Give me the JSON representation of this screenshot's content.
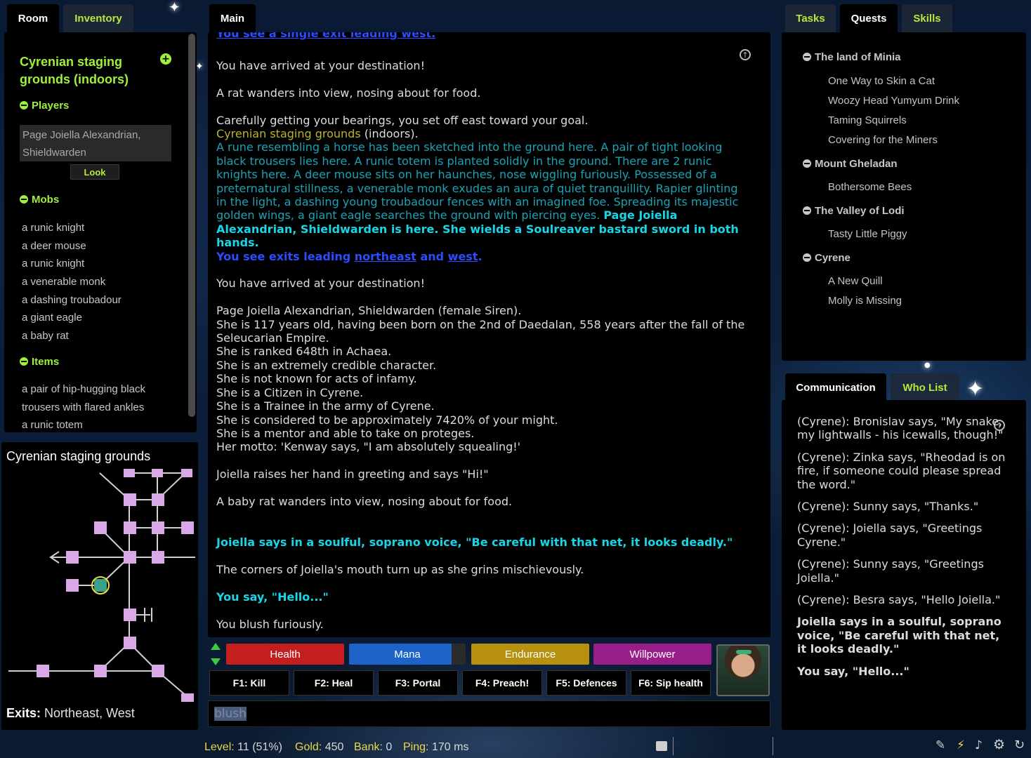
{
  "left_tabs": [
    "Room",
    "Inventory"
  ],
  "room": {
    "title": "Cyrenian staging grounds (indoors)",
    "players_heading": "Players",
    "player": "Page Joiella Alexandrian, Shieldwarden",
    "look_label": "Look",
    "mobs_heading": "Mobs",
    "mobs": [
      "a runic knight",
      "a deer mouse",
      "a runic knight",
      "a venerable monk",
      "a dashing troubadour",
      "a giant eagle",
      "a baby rat"
    ],
    "items_heading": "Items",
    "items": [
      "a pair of hip-hugging black trousers with flared ankles",
      "a runic totem"
    ]
  },
  "map": {
    "title": "Cyrenian staging grounds",
    "exits_label": "Exits:",
    "exits_value": "Northeast, West"
  },
  "main_tab": "Main",
  "main": {
    "top_cut": "You see a single exit leading west.",
    "arrived_1": "You have arrived at your destination!",
    "rat": "A rat wanders into view, nosing about for food.",
    "bearings": "Carefully getting your bearings, you set off east toward your goal.",
    "room_name": "Cyrenian staging grounds",
    "room_indoors": " (indoors).",
    "room_desc": "A rune resembling a horse has been sketched into the ground here. A pair of tight looking black trousers lies here. A runic totem is planted solidly in the ground. There are 2 runic knights here. A deer mouse sits on her haunches, nose wiggling furiously. Possessed of a preternatural stillness, a venerable monk exudes an aura of quiet tranquillity. Rapier glinting in the light, a dashing young troubadour fences with an imagined foe. Spreading its majestic golden wings, a giant eagle searches the ground with piercing eyes. ",
    "room_player": "Page Joiella Alexandrian, Shieldwarden is here. She wields a Soulreaver bastard sword in both hands.",
    "exits_prefix": "You see exits leading ",
    "exit_ne": "northeast",
    "exits_and": " and ",
    "exit_w": "west",
    "exits_end": ".",
    "arrived_2": "You have arrived at your destination!",
    "who": [
      "Page Joiella Alexandrian, Shieldwarden (female Siren).",
      "She is 117 years old, having been born on the 2nd of Daedalan, 558 years after the fall of the Seleucarian Empire.",
      "She is ranked 648th in Achaea.",
      "She is an extremely credible character.",
      "She is not known for acts of infamy.",
      "She is a Citizen in Cyrene.",
      "She is a Trainee in the army of Cyrene.",
      "She is considered to be approximately 7420% of your might.",
      "She is a mentor and able to take on proteges.",
      "Her motto: 'Kenway says, \"I am absolutely squealing!'"
    ],
    "greeting": "Joiella raises her hand in greeting and says \"Hi!\"",
    "baby_rat": "A baby rat wanders into view, nosing about for food.",
    "says": "Joiella says in a soulful, soprano voice, \"Be careful with that net, it looks deadly.\"",
    "grins": "The corners of Joiella's mouth turn up as she grins mischievously.",
    "you_say": "You say, \"Hello...\"",
    "blush": "You blush furiously."
  },
  "stats": {
    "health": "Health",
    "mana": "Mana",
    "endurance": "Endurance",
    "willpower": "Willpower",
    "colors": {
      "health": "#c41e1e",
      "mana": "#1e64c8",
      "endurance": "#b8900f",
      "willpower": "#9a1e8a"
    }
  },
  "fkeys": [
    "F1: Kill",
    "F2: Heal",
    "F3: Portal",
    "F4: Preach!",
    "F5: Defences",
    "F6: Sip health"
  ],
  "command_input": "blush",
  "status_bar": {
    "level_label": "Level:",
    "level_value": "11 (51%)",
    "gold_label": "Gold:",
    "gold_value": "450",
    "bank_label": "Bank:",
    "bank_value": "0",
    "ping_label": "Ping:",
    "ping_value": "170 ms"
  },
  "right_tabs": [
    "Tasks",
    "Quests",
    "Skills"
  ],
  "quests": [
    {
      "region": "The land of Minia",
      "items": [
        "One Way to Skin a Cat",
        "Woozy Head Yumyum Drink",
        "Taming Squirrels",
        "Covering for the Miners"
      ]
    },
    {
      "region": "Mount Gheladan",
      "items": [
        "Bothersome Bees"
      ]
    },
    {
      "region": "The Valley of Lodi",
      "items": [
        "Tasty Little Piggy"
      ]
    },
    {
      "region": "Cyrene",
      "items": [
        "A New Quill",
        "Molly is Missing"
      ]
    }
  ],
  "comm_tabs": [
    "Communication",
    "Who List"
  ],
  "comm": [
    "(Cyrene): Bronislav says, \"My snake, my lightwalls - his icewalls, though!\"",
    "(Cyrene): Zinka says, \"Rheodad is on fire, if someone could please spread the word.\"",
    "(Cyrene): Sunny says, \"Thanks.\"",
    "(Cyrene): Joiella says, \"Greetings Cyrene.\"",
    "(Cyrene): Sunny says, \"Greetings Joiella.\"",
    "(Cyrene): Besra says, \"Hello Joiella.\""
  ],
  "comm_says": "Joiella says in a soulful, soprano voice, \"Be careful with that net, it looks deadly.\"",
  "comm_you_say": "You say, \"Hello...\""
}
